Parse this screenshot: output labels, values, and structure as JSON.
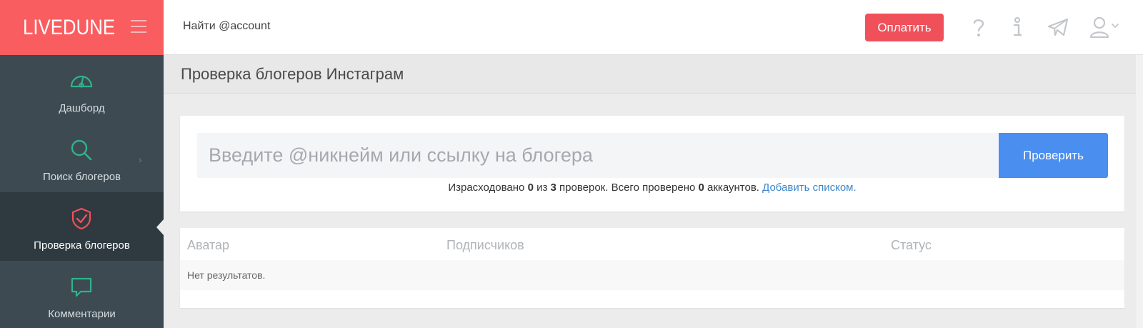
{
  "brand": {
    "logo": "LIVEDUNE"
  },
  "sidebar": {
    "items": [
      {
        "label": "Дашборд",
        "icon": "speedometer-icon"
      },
      {
        "label": "Поиск блогеров",
        "icon": "search-icon"
      },
      {
        "label": "Проверка блогеров",
        "icon": "shield-check-icon",
        "active": true
      },
      {
        "label": "Комментарии",
        "icon": "comment-icon"
      }
    ]
  },
  "topbar": {
    "search_text": "Найти @account",
    "pay_label": "Оплатить",
    "icons": [
      "question-icon",
      "info-icon",
      "telegram-icon",
      "user-icon"
    ]
  },
  "page": {
    "title": "Проверка блогеров Инстаграм"
  },
  "check": {
    "placeholder": "Введите @никнейм или ссылку на блогера",
    "button_label": "Проверить",
    "usage": {
      "prefix": "Израсходовано",
      "used": "0",
      "of": "из",
      "total": "3",
      "mid": "проверок. Всего проверено",
      "checked": "0",
      "suffix": "аккаунтов.",
      "link": "Добавить списком."
    }
  },
  "results": {
    "columns": [
      "Аватар",
      "Подписчиков",
      "Статус"
    ],
    "empty_text": "Нет результатов."
  },
  "colors": {
    "brand": "#f95d5f",
    "sidebar": "#3d4a52",
    "pay_button": "#f0505a",
    "check_button": "#4a8ef0",
    "icon_green": "#2fb38a",
    "icon_red": "#f0505a"
  }
}
